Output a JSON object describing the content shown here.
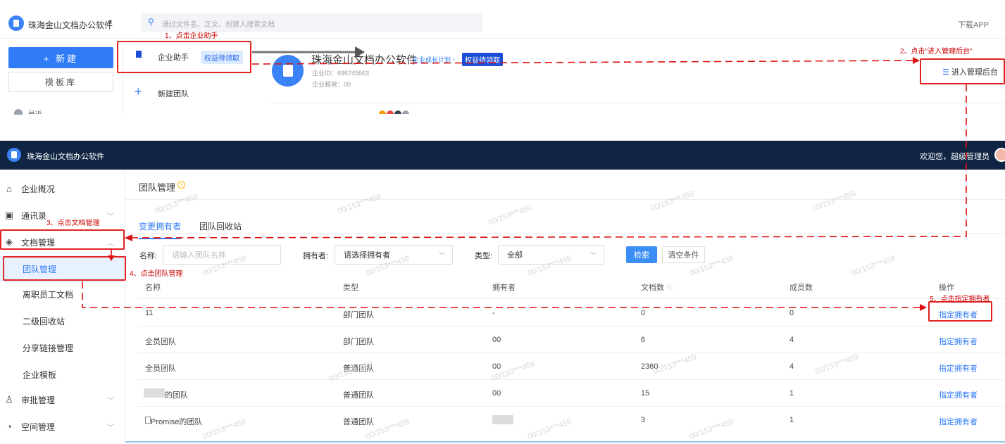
{
  "top": {
    "company": "珠海金山文档办公软件",
    "search_placeholder": "通过文件名、正文、创建人搜索文档",
    "download": "下载APP",
    "btn_new": "+ 新建",
    "btn_template": "模板库",
    "side_partial": "最近",
    "panel": {
      "assistant": "企业助手",
      "assistant_tag": "权益待领取",
      "new_team": "新建团队"
    },
    "enterprise": {
      "name": "珠海金山文档办公软件",
      "growth": "企业成长计划",
      "tag": "权益待领取",
      "id": "企业ID：696745663",
      "admin": "企业超管：00"
    },
    "enter_admin": "进入管理后台"
  },
  "admin": {
    "company": "珠海金山文档办公软件",
    "welcome": "欢迎您，超级管理员",
    "sidebar": [
      {
        "label": "企业概况",
        "icon": "home-icon"
      },
      {
        "label": "通讯录",
        "icon": "contacts-icon"
      },
      {
        "label": "文档管理",
        "icon": "layers-icon"
      },
      {
        "label": "团队管理"
      },
      {
        "label": "离职员工文档"
      },
      {
        "label": "二级回收站"
      },
      {
        "label": "分享链接管理"
      },
      {
        "label": "企业模板"
      },
      {
        "label": "审批管理",
        "icon": "user-icon"
      },
      {
        "label": "空间管理",
        "icon": "pie-icon"
      }
    ],
    "page_title": "团队管理",
    "tabs": [
      "变更拥有者",
      "团队回收站"
    ],
    "filters": {
      "name_label": "名称:",
      "name_placeholder": "请输入团队名称",
      "owner_label": "拥有者:",
      "owner_value": "请选择拥有者",
      "type_label": "类型:",
      "type_value": "全部",
      "search_btn": "检索",
      "clear_btn": "清空条件"
    },
    "table": {
      "headers": [
        "名称",
        "类型",
        "拥有者",
        "文档数",
        "成员数",
        "操作"
      ],
      "rows": [
        [
          "11",
          "部门团队",
          "-",
          "0",
          "0",
          "指定拥有者"
        ],
        [
          "全员团队",
          "部门团队",
          "00",
          "6",
          "4",
          "指定拥有者"
        ],
        [
          "全员团队",
          "普通团队",
          "00",
          "2360",
          "4",
          "指定拥有者"
        ],
        [
          "的团队",
          "普通团队",
          "00",
          "15",
          "1",
          "指定拥有者"
        ],
        [
          "Promise的团队",
          "普通团队",
          "",
          "3",
          "1",
          "指定拥有者"
        ]
      ]
    }
  },
  "annotations": {
    "a1": "1、点击企业助手",
    "a2": "2、点击\"进入管理后台\"",
    "a3": "3、点击文档管理",
    "a4": "4、点击团队管理",
    "a5": "5、点击指定拥有者"
  },
  "watermark": "00/153***459"
}
